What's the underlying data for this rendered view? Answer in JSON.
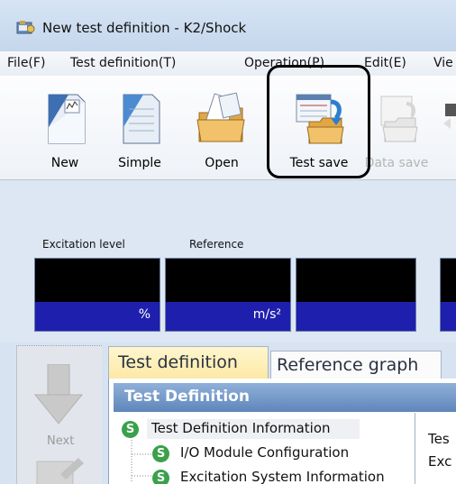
{
  "window": {
    "title": "New test definition - K2/Shock"
  },
  "menu": [
    {
      "label": "File(F)"
    },
    {
      "label": "Test definition(T)"
    },
    {
      "label": "Operation(P)"
    },
    {
      "label": "Edit(E)"
    },
    {
      "label": "Vie"
    }
  ],
  "toolbar": {
    "new": "New",
    "simple": "Simple",
    "open": "Open",
    "test_save": "Test save",
    "data_save": "Data save"
  },
  "monitor": {
    "excitation_label": "Excitation level",
    "reference_label": "Reference",
    "excitation_unit": "%",
    "reference_unit": "m/s²"
  },
  "side": {
    "next": "Next"
  },
  "tabs": {
    "active": "Test definition",
    "other": "Reference graph"
  },
  "section": {
    "header": "Test Definition"
  },
  "tree": {
    "badge": "S",
    "items": [
      {
        "label": "Test Definition Information"
      },
      {
        "label": "I/O Module Configuration"
      },
      {
        "label": "Excitation System Information"
      }
    ]
  },
  "detail": {
    "line1": "Tes",
    "line2": "Exc"
  },
  "colors": {
    "meter_unit_bg": "#1f1fae",
    "section_header": "#6f93c5",
    "tab_active": "#fde9a6",
    "badge": "#3aa14a"
  }
}
